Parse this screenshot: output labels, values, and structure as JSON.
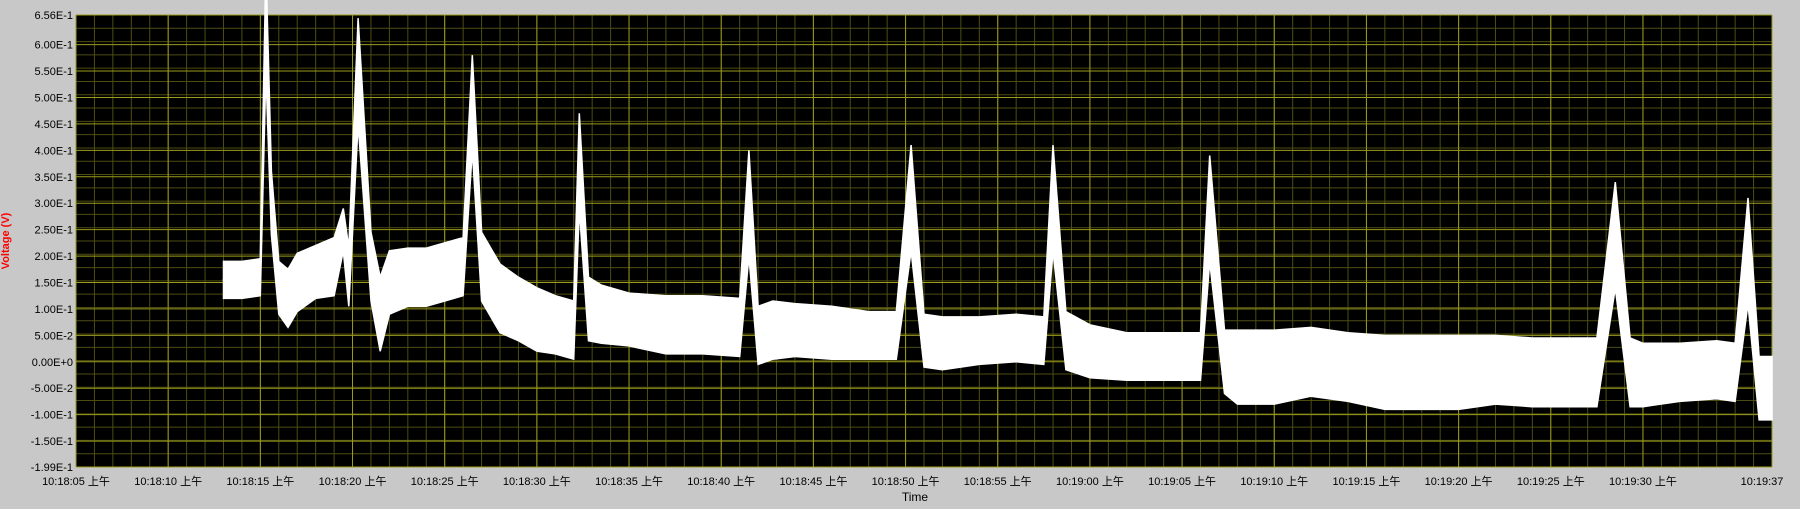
{
  "colors": {
    "background": "#c8c8c8",
    "plot_bg": "#000000",
    "grid_major": "#9b9b1e",
    "grid_minor": "#4d4d12",
    "trace": "#ffffff",
    "ylabel": "#ff0000",
    "tick_text": "#000000"
  },
  "chart_data": {
    "type": "line",
    "title": "",
    "xlabel": "Time",
    "ylabel": "Voltage (V)",
    "grid": true,
    "ylim": [
      -0.199,
      0.656
    ],
    "xlim": [
      "10:18:05",
      "10:19:37"
    ],
    "y_ticks": [
      "6.56E-1",
      "6.00E-1",
      "5.50E-1",
      "5.00E-1",
      "4.50E-1",
      "4.00E-1",
      "3.50E-1",
      "3.00E-1",
      "2.50E-1",
      "2.00E-1",
      "1.50E-1",
      "1.00E-1",
      "5.00E-2",
      "0.00E+0",
      "-5.00E-2",
      "-1.00E-1",
      "-1.50E-1",
      "-1.99E-1"
    ],
    "y_tick_values": [
      0.656,
      0.6,
      0.55,
      0.5,
      0.45,
      0.4,
      0.35,
      0.3,
      0.25,
      0.2,
      0.15,
      0.1,
      0.05,
      0,
      -0.05,
      -0.1,
      -0.15,
      -0.199
    ],
    "x_ticks": [
      "10:18:05 上午",
      "10:18:10 上午",
      "10:18:15 上午",
      "10:18:20 上午",
      "10:18:25 上午",
      "10:18:30 上午",
      "10:18:35 上午",
      "10:18:40 上午",
      "10:18:45 上午",
      "10:18:50 上午",
      "10:18:55 上午",
      "10:19:00 上午",
      "10:19:05 上午",
      "10:19:10 上午",
      "10:19:15 上午",
      "10:19:20 上午",
      "10:19:25 上午",
      "10:19:30 上午",
      "10:19:37"
    ],
    "x_tick_values": [
      "10:18:05",
      "10:18:10",
      "10:18:15",
      "10:18:20",
      "10:18:25",
      "10:18:30",
      "10:18:35",
      "10:18:40",
      "10:18:45",
      "10:18:50",
      "10:18:55",
      "10:19:00",
      "10:19:05",
      "10:19:10",
      "10:19:15",
      "10:19:20",
      "10:19:25",
      "10:19:30",
      "10:19:37"
    ],
    "series": [
      {
        "x": [
          "10:18:13",
          "10:18:14",
          "10:18:15",
          "10:18:15.3",
          "10:18:15.6",
          "10:18:16",
          "10:18:16.5",
          "10:18:17",
          "10:18:18",
          "10:18:19",
          "10:18:19.5",
          "10:18:19.8",
          "10:18:20.3",
          "10:18:21",
          "10:18:21.5",
          "10:18:22",
          "10:18:23",
          "10:18:24",
          "10:18:25",
          "10:18:26",
          "10:18:26.5",
          "10:18:27",
          "10:18:28",
          "10:18:29",
          "10:18:30",
          "10:18:31",
          "10:18:32",
          "10:18:32.3",
          "10:18:32.8",
          "10:18:33.5",
          "10:18:35",
          "10:18:37",
          "10:18:39",
          "10:18:41",
          "10:18:41.5",
          "10:18:42",
          "10:18:42.8",
          "10:18:44",
          "10:18:46",
          "10:18:48",
          "10:18:49.5",
          "10:18:50.3",
          "10:18:51",
          "10:18:52",
          "10:18:54",
          "10:18:56",
          "10:18:57.5",
          "10:18:58",
          "10:18:58.7",
          "10:19:00",
          "10:19:02",
          "10:19:04",
          "10:19:06",
          "10:19:06.5",
          "10:19:07.3",
          "10:19:08",
          "10:19:10",
          "10:19:12",
          "10:19:14",
          "10:19:16",
          "10:19:18",
          "10:19:20",
          "10:19:22",
          "10:19:24",
          "10:19:26",
          "10:19:27.5",
          "10:19:28.5",
          "10:19:29.3",
          "10:19:30",
          "10:19:32",
          "10:19:34",
          "10:19:35",
          "10:19:35.7",
          "10:19:36.3",
          "10:19:37"
        ],
        "y": [
          0.155,
          0.155,
          0.16,
          0.65,
          0.3,
          0.14,
          0.12,
          0.15,
          0.17,
          0.18,
          0.25,
          0.16,
          0.55,
          0.18,
          0.09,
          0.15,
          0.16,
          0.16,
          0.17,
          0.18,
          0.49,
          0.18,
          0.12,
          0.1,
          0.08,
          0.07,
          0.06,
          0.38,
          0.1,
          0.09,
          0.08,
          0.07,
          0.07,
          0.065,
          0.3,
          0.05,
          0.06,
          0.06,
          0.055,
          0.05,
          0.05,
          0.31,
          0.04,
          0.035,
          0.04,
          0.045,
          0.04,
          0.31,
          0.04,
          0.02,
          0.01,
          0.01,
          0.01,
          0.29,
          0.0,
          -0.01,
          -0.01,
          0.0,
          -0.01,
          -0.02,
          -0.02,
          -0.02,
          -0.015,
          -0.02,
          -0.02,
          -0.02,
          0.24,
          -0.02,
          -0.025,
          -0.02,
          -0.015,
          -0.02,
          0.21,
          -0.05,
          -0.05
        ],
        "band": [
          0.07,
          0.07,
          0.07,
          0.2,
          0.12,
          0.1,
          0.11,
          0.11,
          0.1,
          0.11,
          0.08,
          0.11,
          0.2,
          0.13,
          0.14,
          0.12,
          0.11,
          0.11,
          0.11,
          0.11,
          0.18,
          0.13,
          0.13,
          0.12,
          0.12,
          0.11,
          0.11,
          0.18,
          0.12,
          0.11,
          0.1,
          0.11,
          0.11,
          0.11,
          0.2,
          0.11,
          0.11,
          0.1,
          0.1,
          0.09,
          0.09,
          0.2,
          0.1,
          0.1,
          0.09,
          0.09,
          0.09,
          0.2,
          0.11,
          0.1,
          0.09,
          0.09,
          0.09,
          0.2,
          0.12,
          0.14,
          0.14,
          0.13,
          0.13,
          0.14,
          0.14,
          0.14,
          0.13,
          0.13,
          0.13,
          0.13,
          0.2,
          0.13,
          0.12,
          0.11,
          0.11,
          0.11,
          0.2,
          0.12,
          0.12
        ]
      }
    ]
  }
}
